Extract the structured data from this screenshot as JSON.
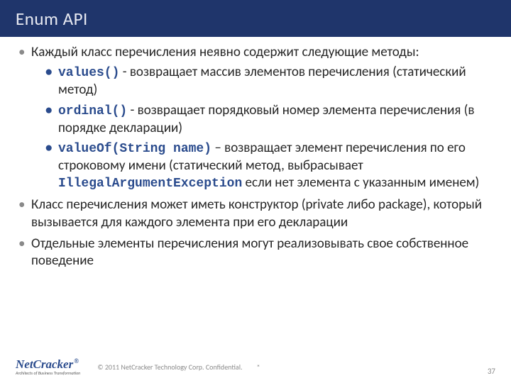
{
  "title": "Enum API",
  "bullets": {
    "b1_intro": "Каждый класс перечисления неявно содержит следующие методы:",
    "b1a_code": "values()",
    "b1a_text": " - возвращает массив элементов перечисления (статический метод)",
    "b1b_code": "ordinal()",
    "b1b_text": " - возвращает порядковый номер элемента перечисления (в порядке декларации)",
    "b1c_code": "valueOf(String name)",
    "b1c_text_pre": " – возвращает элемент перечисления по его строковому имени (статический метод, выбрасывает ",
    "b1c_code2": "IllegalArgumentException",
    "b1c_text_post": " если нет элемента с указанным именем)",
    "b2": "Класс перечисления может иметь конструктор (private либо package), который вызывается для каждого элемента при его декларации",
    "b3": "Отдельные элементы перечисления могут реализовывать свое собственное поведение"
  },
  "footer": {
    "logo_main": "NetCracker",
    "logo_tag": "Architects of Business Transformation",
    "copyright": "© 2011 NetCracker Technology Corp. Confidential.",
    "date": "*",
    "page": "37"
  }
}
